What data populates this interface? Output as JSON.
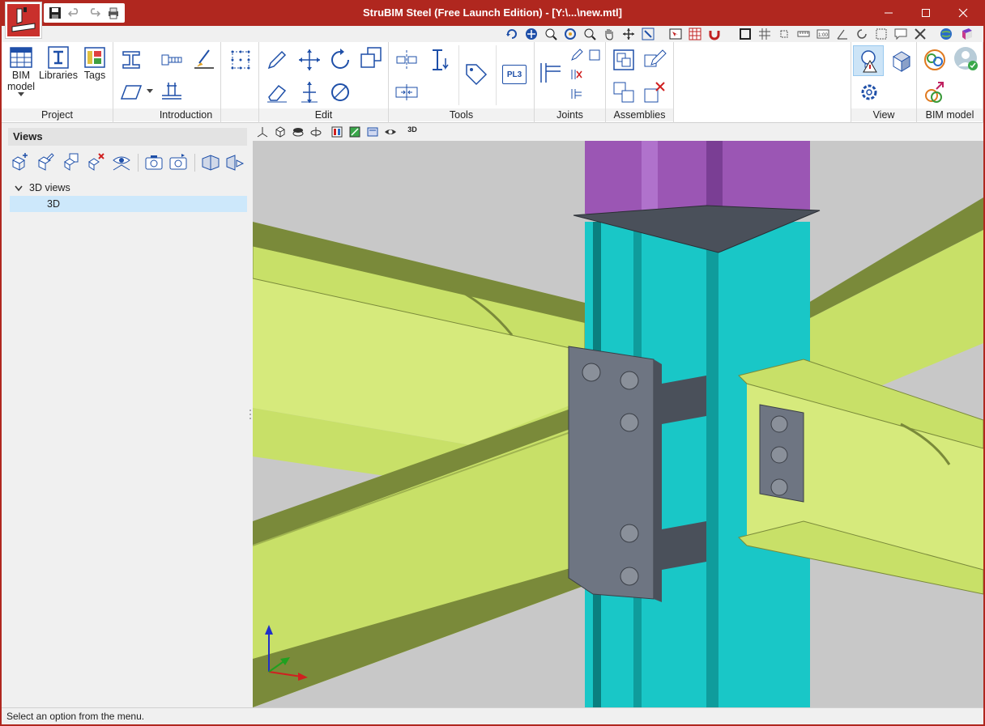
{
  "window": {
    "title": "StruBIM Steel (Free Launch Edition) - [Y:\\...\\new.mtl]",
    "frame_color": "#b0271f"
  },
  "title_bar": {
    "quick_access": [
      "save-icon",
      "undo-icon",
      "redo-icon",
      "print-icon"
    ],
    "controls": [
      "minimize-icon",
      "maximize-icon",
      "close-icon"
    ]
  },
  "ribbon": {
    "groups": {
      "project": {
        "label": "Project",
        "buttons": [
          {
            "label_line1": "BIM",
            "label_line2": "model",
            "icon": "bim-model-icon"
          },
          {
            "label": "Libraries",
            "icon": "libraries-icon"
          },
          {
            "label": "Tags",
            "icon": "tags-icon"
          }
        ]
      },
      "introduction": {
        "label": "Introduction"
      },
      "edit": {
        "label": "Edit"
      },
      "tools": {
        "label": "Tools",
        "pl3_label": "PL3"
      },
      "joints": {
        "label": "Joints"
      },
      "assemblies": {
        "label": "Assemblies"
      },
      "view": {
        "label": "View"
      },
      "bim_model": {
        "label": "BIM model"
      }
    }
  },
  "left_panel": {
    "header": "Views",
    "tree": {
      "group_label": "3D views",
      "items": [
        {
          "label": "3D"
        }
      ]
    }
  },
  "canvas_toolbar": {
    "label_3d": "3D"
  },
  "viewport": {
    "colors": {
      "background": "#c8c8c8",
      "column": "#19c7c7",
      "column_dark": "#0f9c9c",
      "top_column": "#9b56b4",
      "beam_top": "#c8e068",
      "beam_web": "#d6ea7c",
      "beam_dark": "#7a8a3a",
      "plate": "#6e7582",
      "bolt": "#8a909a"
    }
  },
  "status_bar": {
    "text": "Select an option from the menu."
  }
}
